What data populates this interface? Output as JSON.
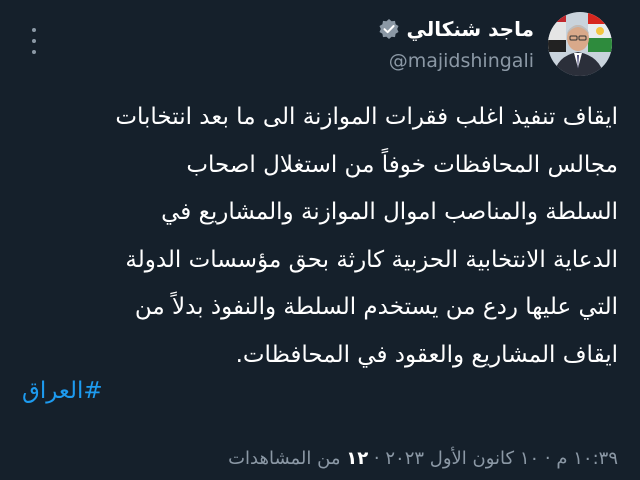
{
  "colors": {
    "background": "#15202b",
    "text_primary": "#ffffff",
    "text_secondary": "#8b98a5",
    "accent_link": "#1d9bf0",
    "verified_badge": "#8b98a5"
  },
  "tweet": {
    "more_icon": "more-vertical-icon",
    "author": {
      "display_name": "ماجد شنكالي",
      "handle": "@majidshingali",
      "verified_icon": "verified-badge-icon",
      "avatar_icon": "user-avatar"
    },
    "text_lines": [
      "ايقاف تنفيذ اغلب فقرات الموازنة الى ما بعد انتخابات",
      "مجالس المحافظات خوفاً من استغلال اصحاب",
      "السلطة والمناصب اموال الموازنة والمشاريع في",
      "الدعاية الانتخابية الحزبية كارثة بحق مؤسسات الدولة",
      "التي عليها ردع من يستخدم السلطة والنفوذ بدلاً من",
      "ايقاف المشاريع والعقود في المحافظات."
    ],
    "hashtag": "#العراق",
    "time": "١٠:٣٩ م",
    "date": "١٠ كانون الأول ٢٠٢٣",
    "views_count": "١٢",
    "views_label": "من المشاهدات"
  }
}
